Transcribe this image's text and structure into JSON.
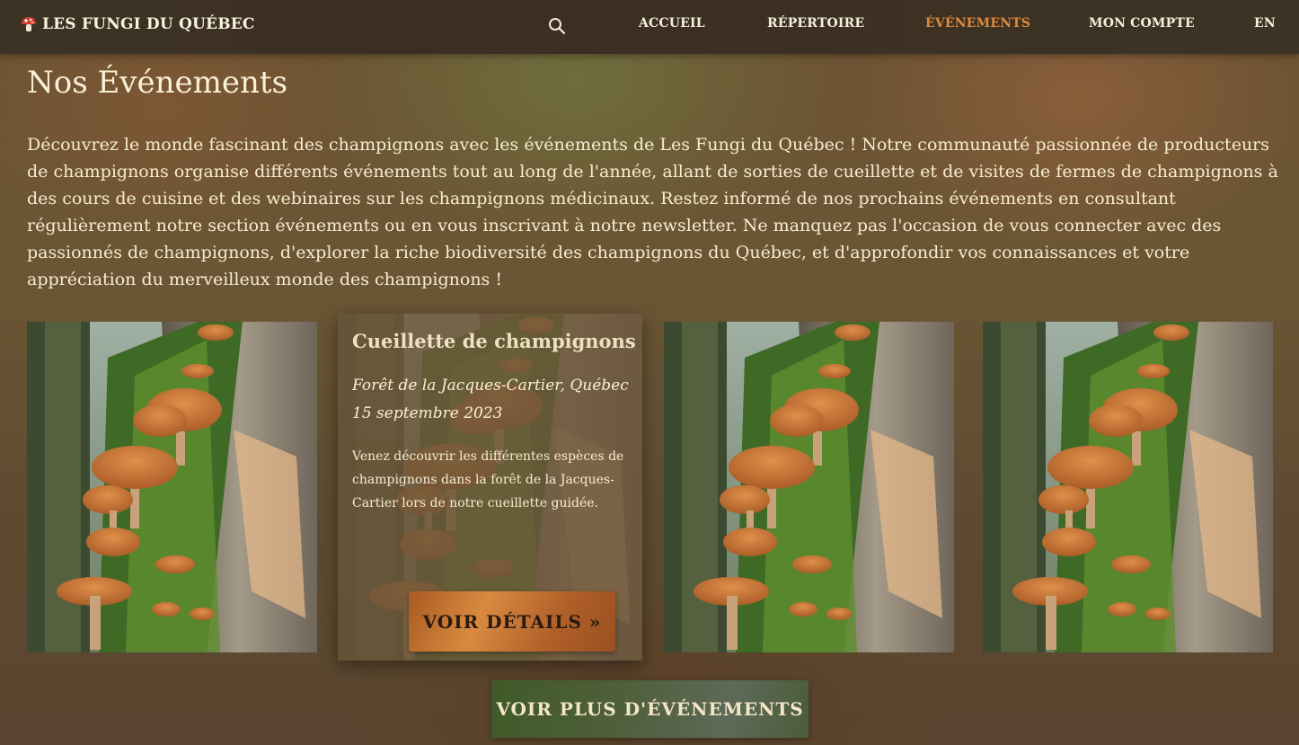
{
  "nav": {
    "brand": "LES FUNGI DU QUÉBEC",
    "brand_icon": "mushroom-icon",
    "search_icon": "search-icon",
    "links": [
      "ACCUEIL",
      "RÉPERTOIRE",
      "ÉVÉNEMENTS",
      "MON COMPTE",
      "EN"
    ],
    "active": "ÉVÉNEMENTS",
    "active_color": "#df8a3c"
  },
  "page": {
    "title": "Nos Événements",
    "intro": "Découvrez le monde fascinant des champignons avec les événements de Les Fungi du Québec ! Notre communauté passionnée de producteurs de champignons organise différents événements tout au long de l'année, allant de sorties de cueillette et de visites de fermes de champignons à des cours de cuisine et des webinaires sur les champignons médicinaux. Restez informé de nos prochains événements en consultant régulièrement notre section événements ou en vous inscrivant à notre newsletter. Ne manquez pas l'occasion de vous connecter avec des passionnés de champignons, d'explorer la riche biodiversité des champignons du Québec, et d'approfondir vos connaissances et votre appréciation du merveilleux monde des champignons !"
  },
  "event": {
    "title": "Cueillette de champignons",
    "location": "Forêt de la Jacques-Cartier, Québec",
    "date": "15 septembre 2023",
    "description": "Venez découvrir les différentes espèces de champignons dans la forêt de la Jacques-Cartier lors de notre cueillette guidée.",
    "details_label": "VOIR DÉTAILS »"
  },
  "more_label": "VOIR PLUS D'ÉVÉNEMENTS",
  "colors": {
    "nav_bg": "#3b2f23",
    "details_button": "#d98a40",
    "more_button": "#4f5f3a"
  }
}
